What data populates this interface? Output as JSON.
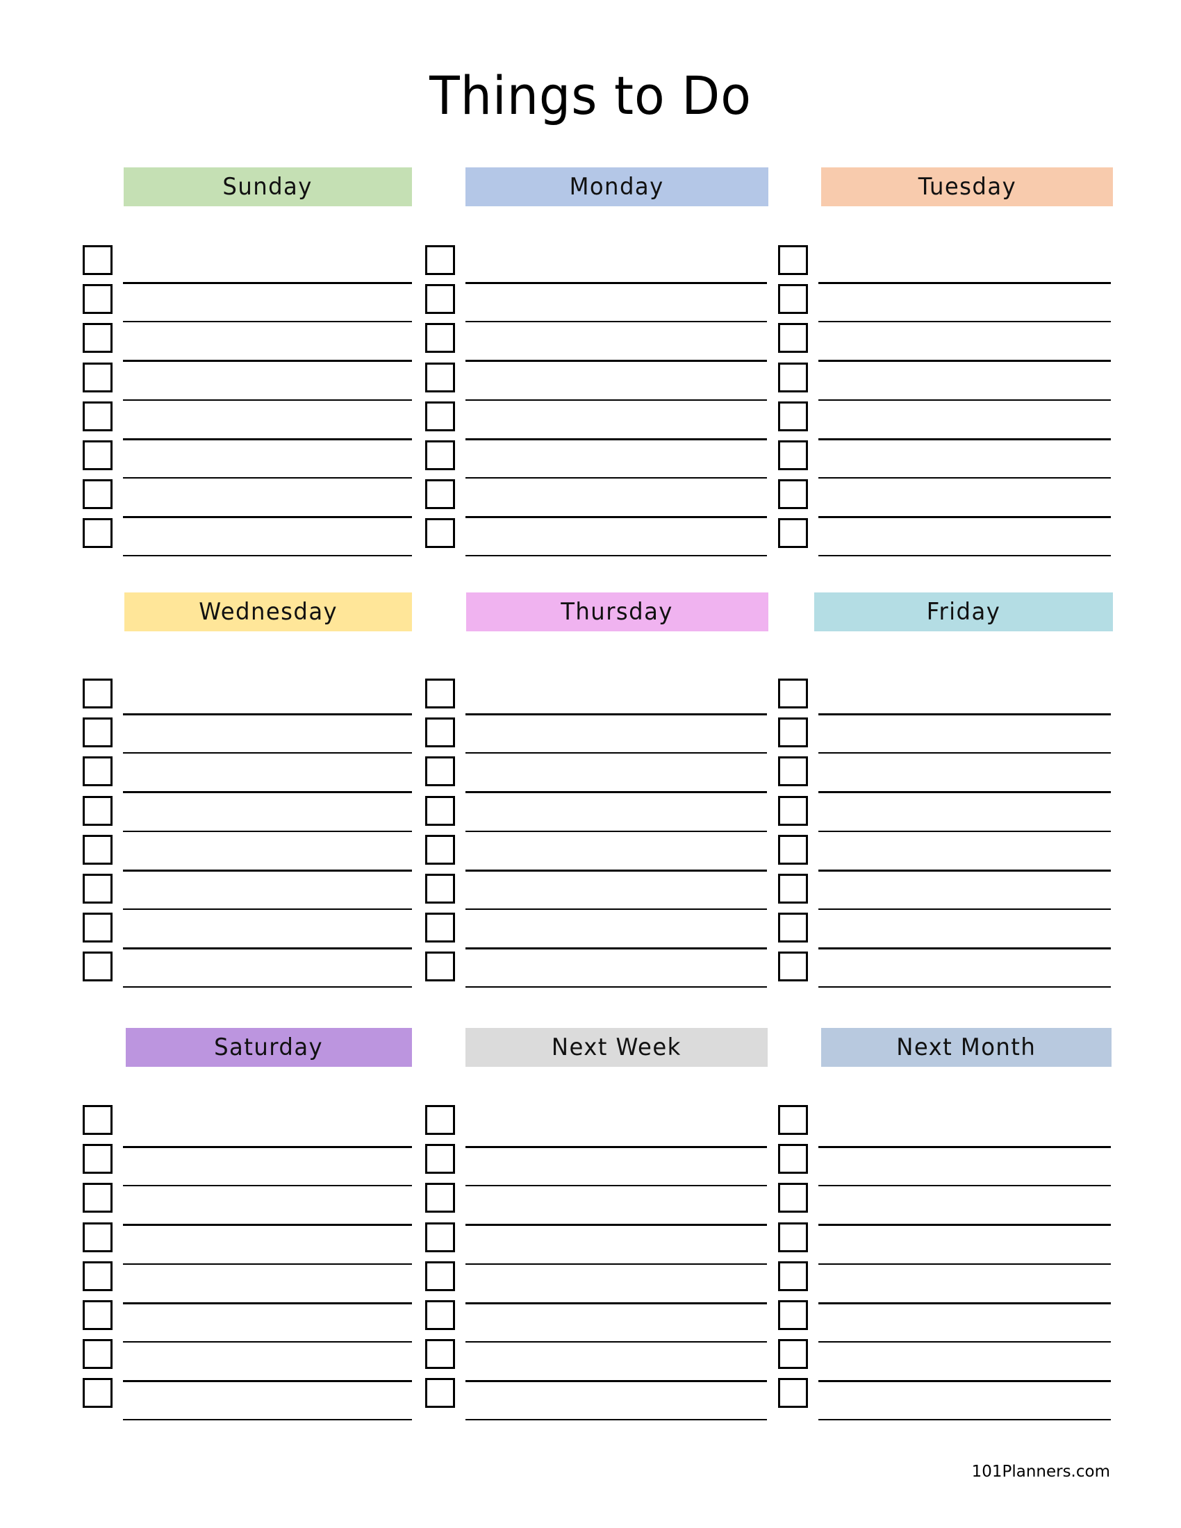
{
  "title": "Things to Do",
  "sections": [
    {
      "label": "Sunday",
      "color": "#C5E0B4",
      "rows": 8
    },
    {
      "label": "Monday",
      "color": "#B4C7E7",
      "rows": 8
    },
    {
      "label": "Tuesday",
      "color": "#F8CBAD",
      "rows": 8
    },
    {
      "label": "Wednesday",
      "color": "#FFE699",
      "rows": 8
    },
    {
      "label": "Thursday",
      "color": "#F0B3F0",
      "rows": 8
    },
    {
      "label": "Friday",
      "color": "#B4DDE4",
      "rows": 8
    },
    {
      "label": "Saturday",
      "color": "#BC95DF",
      "rows": 8
    },
    {
      "label": "Next Week",
      "color": "#DBDBDB",
      "rows": 8
    },
    {
      "label": "Next Month",
      "color": "#B8C9DF",
      "rows": 8
    }
  ],
  "footer": "101Planners.com"
}
